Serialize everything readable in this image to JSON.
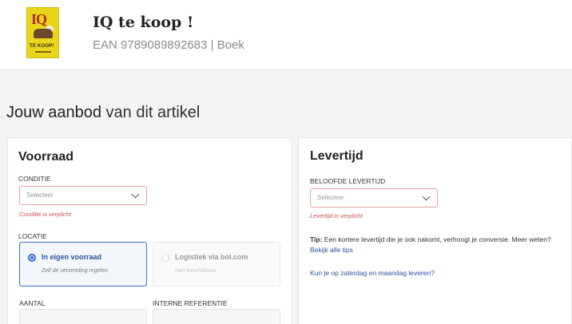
{
  "product": {
    "title": "IQ te koop !",
    "ean": "EAN 9789089892683 | Boek",
    "cover": {
      "title_text": "IQ",
      "sub_text": "TE KOOP!"
    }
  },
  "heading": {
    "strong": "Jouw aanbod",
    "rest": " van dit artikel"
  },
  "voorraad": {
    "title": "Voorraad",
    "conditie_label": "CONDITIE",
    "conditie_placeholder": "Selecteer",
    "conditie_error": "Conditie is verplicht",
    "locatie_label": "LOCATIE",
    "options": [
      {
        "title": "In eigen voorraad",
        "subtitle": "Zelf de verzending regelen",
        "selected": true
      },
      {
        "title": "Logistiek via bol.com",
        "subtitle": "Niet beschikbaar",
        "selected": false
      }
    ],
    "aantal_label": "AANTAL",
    "referentie_label": "INTERNE REFERENTIE"
  },
  "levertijd": {
    "title": "Levertijd",
    "beloofde_label": "BELOOFDE LEVERTIJD",
    "beloofde_placeholder": "Selecteer",
    "beloofde_error": "Levertijd is verplicht",
    "tip_label": "Tip:",
    "tip_text": " Een kortere levertijd die je ook nakomt, verhoogt je conversie. Meer weten?",
    "tips_link": "Bekijk alle tips",
    "weekend_link": "Kun je op zaterdag en maandag leveren?"
  },
  "colors": {
    "accent": "#2853a0",
    "error": "#d14b4b",
    "cover": "#e8d51c"
  }
}
